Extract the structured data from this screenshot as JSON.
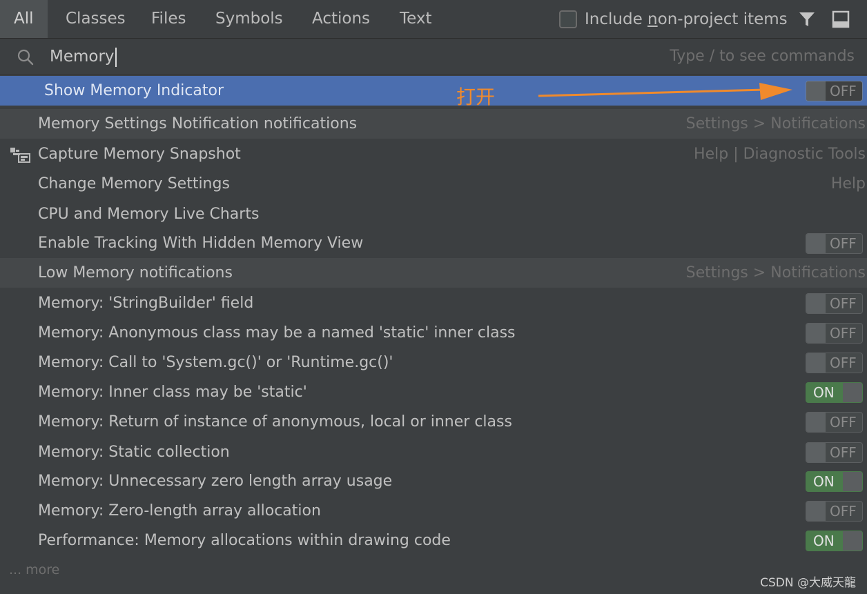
{
  "tabs": [
    {
      "label": "All",
      "active": true
    },
    {
      "label": "Classes",
      "active": false
    },
    {
      "label": "Files",
      "active": false
    },
    {
      "label": "Symbols",
      "active": false
    },
    {
      "label": "Actions",
      "active": false
    },
    {
      "label": "Text",
      "active": false
    }
  ],
  "include_option": {
    "label_prefix": "Include ",
    "label_mnemonic": "n",
    "label_suffix": "on-project items",
    "checked": false
  },
  "toolbar_icons": [
    "filter-icon",
    "preview-panel-icon"
  ],
  "search": {
    "value": "Memory",
    "hint": "Type / to see commands"
  },
  "annotation": {
    "text": "打开",
    "color": "#f08a2c"
  },
  "results": [
    {
      "label": "Show Memory Indicator",
      "toggle": "OFF",
      "selected": true
    },
    {
      "label": "Memory Settings Notification notifications",
      "hint": "Settings > Notifications",
      "alt": true
    },
    {
      "label": "Capture Memory Snapshot",
      "hint": "Help | Diagnostic Tools",
      "icon": "snapshot-icon"
    },
    {
      "label": "Change Memory Settings",
      "hint": "Help"
    },
    {
      "label": "CPU and Memory Live Charts"
    },
    {
      "label": "Enable Tracking With Hidden Memory View",
      "toggle": "OFF"
    },
    {
      "label": "Low Memory notifications",
      "hint": "Settings > Notifications",
      "alt": true
    },
    {
      "label": "Memory: 'StringBuilder' field",
      "toggle": "OFF"
    },
    {
      "label": "Memory: Anonymous class may be a named 'static' inner class",
      "toggle": "OFF"
    },
    {
      "label": "Memory: Call to 'System.gc()' or 'Runtime.gc()'",
      "toggle": "OFF"
    },
    {
      "label": "Memory: Inner class may be 'static'",
      "toggle": "ON"
    },
    {
      "label": "Memory: Return of instance of anonymous, local or inner class",
      "toggle": "OFF"
    },
    {
      "label": "Memory: Static collection",
      "toggle": "OFF"
    },
    {
      "label": "Memory: Unnecessary zero length array usage",
      "toggle": "ON"
    },
    {
      "label": "Memory: Zero-length array allocation",
      "toggle": "OFF"
    },
    {
      "label": "Performance: Memory allocations within drawing code",
      "toggle": "ON"
    }
  ],
  "more_label": "... more",
  "watermark": "CSDN @大威天龍",
  "colors": {
    "background": "#3c3f41",
    "selection": "#4b6eaf",
    "toggle_on": "#4a7a4b",
    "annotation": "#f08a2c"
  }
}
